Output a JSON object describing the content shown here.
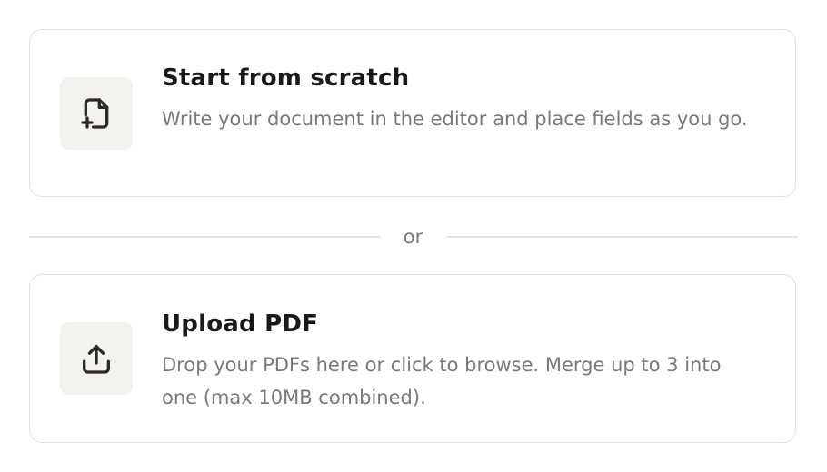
{
  "options": {
    "scratch": {
      "icon": "file-plus-icon",
      "title": "Start from scratch",
      "description": "Write your document in the editor and place fields as you go."
    },
    "upload": {
      "icon": "upload-icon",
      "title": "Upload PDF",
      "description": "Drop your PDFs here or click to browse. Merge up to 3 into one (max 10MB combined)."
    }
  },
  "divider": {
    "label": "or"
  },
  "colors": {
    "title": "#1c1a18",
    "description": "#7c7873",
    "border": "#e4e1dd",
    "icon_tile": "#f4f2ef"
  }
}
